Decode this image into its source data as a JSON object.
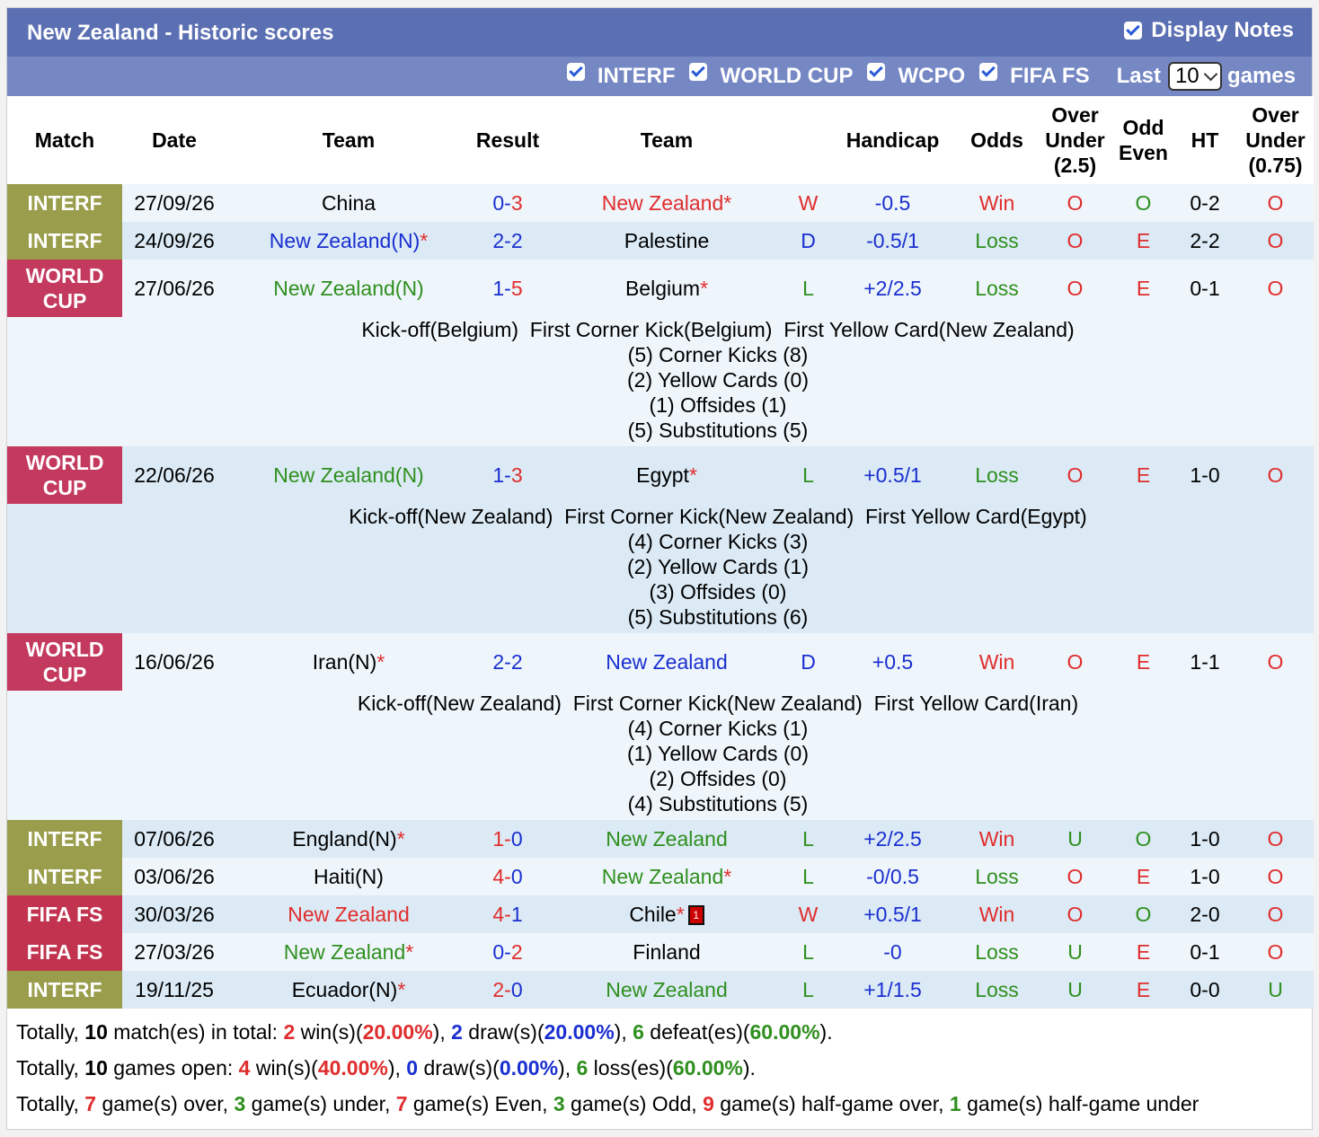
{
  "header": {
    "title": "New Zealand - Historic scores",
    "display_notes": "Display Notes"
  },
  "filters": {
    "items": [
      "INTERF",
      "WORLD CUP",
      "WCPO",
      "FIFA FS"
    ],
    "last_label": "Last",
    "last_value": "10",
    "games_label": "games"
  },
  "columns": [
    "Match",
    "Date",
    "Team",
    "Result",
    "Team",
    "",
    "Handicap",
    "Odds",
    "Over Under (2.5)",
    "Odd Even",
    "HT",
    "Over Under (0.75)"
  ],
  "rows": [
    {
      "league": "INTERF",
      "date": "27/09/26",
      "home": "China",
      "home_color": "#000000",
      "home_star": "",
      "res_h": "0",
      "res_a": "3",
      "res_h_color": "#1a2fd0",
      "res_a_color": "#e02d2d",
      "away": "New Zealand",
      "away_color": "#e02d2d",
      "away_star": "*",
      "wdl": "W",
      "handicap": "-0.5",
      "odds": "Win",
      "ou": "O",
      "oe": "O",
      "ht": "0-2",
      "ou2": "O"
    },
    {
      "league": "INTERF",
      "date": "24/09/26",
      "home": "New Zealand(N)",
      "home_color": "#1a2fd0",
      "home_star": "*",
      "res_h": "2",
      "res_a": "2",
      "res_h_color": "#1a2fd0",
      "res_a_color": "#1a2fd0",
      "away": "Palestine",
      "away_color": "#000000",
      "away_star": "",
      "wdl": "D",
      "handicap": "-0.5/1",
      "odds": "Loss",
      "ou": "O",
      "oe": "E",
      "ht": "2-2",
      "ou2": "O"
    },
    {
      "league": "WORLD CUP",
      "date": "27/06/26",
      "home": "New Zealand(N)",
      "home_color": "#2f8f1f",
      "home_star": "",
      "res_h": "1",
      "res_a": "5",
      "res_h_color": "#1a2fd0",
      "res_a_color": "#e02d2d",
      "away": "Belgium",
      "away_color": "#000000",
      "away_star": "*",
      "wdl": "L",
      "handicap": "+2/2.5",
      "odds": "Loss",
      "ou": "O",
      "oe": "E",
      "ht": "0-1",
      "ou2": "O",
      "notes": {
        "line1": "Kick-off(Belgium)  First Corner Kick(Belgium)  First Yellow Card(New Zealand)",
        "corners": "(5) Corner Kicks (8)",
        "yellow": "(2) Yellow Cards (0)",
        "offsides": "(1) Offsides (1)",
        "subs": "(5) Substitutions (5)"
      }
    },
    {
      "league": "WORLD CUP",
      "date": "22/06/26",
      "home": "New Zealand(N)",
      "home_color": "#2f8f1f",
      "home_star": "",
      "res_h": "1",
      "res_a": "3",
      "res_h_color": "#1a2fd0",
      "res_a_color": "#e02d2d",
      "away": "Egypt",
      "away_color": "#000000",
      "away_star": "*",
      "wdl": "L",
      "handicap": "+0.5/1",
      "odds": "Loss",
      "ou": "O",
      "oe": "E",
      "ht": "1-0",
      "ou2": "O",
      "notes": {
        "line1": "Kick-off(New Zealand)  First Corner Kick(New Zealand)  First Yellow Card(Egypt)",
        "corners": "(4) Corner Kicks (3)",
        "yellow": "(2) Yellow Cards (1)",
        "offsides": "(3) Offsides (0)",
        "subs": "(5) Substitutions (6)"
      }
    },
    {
      "league": "WORLD CUP",
      "date": "16/06/26",
      "home": "Iran(N)",
      "home_color": "#000000",
      "home_star": "*",
      "res_h": "2",
      "res_a": "2",
      "res_h_color": "#1a2fd0",
      "res_a_color": "#1a2fd0",
      "away": "New Zealand",
      "away_color": "#1a2fd0",
      "away_star": "",
      "wdl": "D",
      "handicap": "+0.5",
      "odds": "Win",
      "ou": "O",
      "oe": "E",
      "ht": "1-1",
      "ou2": "O",
      "notes": {
        "line1": "Kick-off(New Zealand)  First Corner Kick(New Zealand)  First Yellow Card(Iran)",
        "corners": "(4) Corner Kicks (1)",
        "yellow": "(1) Yellow Cards (0)",
        "offsides": "(2) Offsides (0)",
        "subs": "(4) Substitutions (5)"
      }
    },
    {
      "league": "INTERF",
      "date": "07/06/26",
      "home": "England(N)",
      "home_color": "#000000",
      "home_star": "*",
      "res_h": "1",
      "res_a": "0",
      "res_h_color": "#e02d2d",
      "res_a_color": "#1a2fd0",
      "away": "New Zealand",
      "away_color": "#2f8f1f",
      "away_star": "",
      "wdl": "L",
      "handicap": "+2/2.5",
      "odds": "Win",
      "ou": "U",
      "oe": "O",
      "ht": "1-0",
      "ou2": "O"
    },
    {
      "league": "INTERF",
      "date": "03/06/26",
      "home": "Haiti(N)",
      "home_color": "#000000",
      "home_star": "",
      "res_h": "4",
      "res_a": "0",
      "res_h_color": "#e02d2d",
      "res_a_color": "#1a2fd0",
      "away": "New Zealand",
      "away_color": "#2f8f1f",
      "away_star": "*",
      "wdl": "L",
      "handicap": "-0/0.5",
      "odds": "Loss",
      "ou": "O",
      "oe": "E",
      "ht": "1-0",
      "ou2": "O"
    },
    {
      "league": "FIFA FS",
      "date": "30/03/26",
      "home": "New Zealand",
      "home_color": "#e02d2d",
      "home_star": "",
      "res_h": "4",
      "res_a": "1",
      "res_h_color": "#e02d2d",
      "res_a_color": "#1a2fd0",
      "away": "Chile",
      "away_color": "#000000",
      "away_star": "*",
      "redcard": "1",
      "wdl": "W",
      "handicap": "+0.5/1",
      "odds": "Win",
      "ou": "O",
      "oe": "O",
      "ht": "2-0",
      "ou2": "O"
    },
    {
      "league": "FIFA FS",
      "date": "27/03/26",
      "home": "New Zealand",
      "home_color": "#2f8f1f",
      "home_star": "*",
      "res_h": "0",
      "res_a": "2",
      "res_h_color": "#1a2fd0",
      "res_a_color": "#e02d2d",
      "away": "Finland",
      "away_color": "#000000",
      "away_star": "",
      "wdl": "L",
      "handicap": "-0",
      "odds": "Loss",
      "ou": "U",
      "oe": "E",
      "ht": "0-1",
      "ou2": "O"
    },
    {
      "league": "INTERF",
      "date": "19/11/25",
      "home": "Ecuador(N)",
      "home_color": "#000000",
      "home_star": "*",
      "res_h": "2",
      "res_a": "0",
      "res_h_color": "#e02d2d",
      "res_a_color": "#1a2fd0",
      "away": "New Zealand",
      "away_color": "#2f8f1f",
      "away_star": "",
      "wdl": "L",
      "handicap": "+1/1.5",
      "odds": "Loss",
      "ou": "U",
      "oe": "E",
      "ht": "0-0",
      "ou2": "U"
    }
  ],
  "colors": {
    "win": "#e02d2d",
    "draw": "#1a2fd0",
    "loss": "#2f8f1f",
    "interf": "#9a9e4c",
    "worldcup": "#c4395e",
    "fifafs": "#c1334e"
  },
  "summary": {
    "line1": {
      "p1": "Totally, ",
      "n": "10",
      "p2": " match(es) in total: ",
      "w": "2",
      "p3": " win(s)(",
      "wp": "20.00%",
      "p4": "), ",
      "d": "2",
      "p5": " draw(s)(",
      "dp": "20.00%",
      "p6": "), ",
      "l": "6",
      "p7": " defeat(es)(",
      "lp": "60.00%",
      "p8": ")."
    },
    "line2": {
      "p1": "Totally, ",
      "n": "10",
      "p2": " games open: ",
      "w": "4",
      "p3": " win(s)(",
      "wp": "40.00%",
      "p4": "), ",
      "d": "0",
      "p5": " draw(s)(",
      "dp": "0.00%",
      "p6": "), ",
      "l": "6",
      "p7": " loss(es)(",
      "lp": "60.00%",
      "p8": ")."
    },
    "line3": {
      "p1": "Totally, ",
      "over": "7",
      "p2": " game(s) over, ",
      "under": "3",
      "p3": " game(s) under, ",
      "even": "7",
      "p4": " game(s) Even, ",
      "odd": "3",
      "p5": " game(s) Odd, ",
      "hgo": "9",
      "p6": " game(s) half-game over, ",
      "hgu": "1",
      "p7": " game(s) half-game under"
    }
  }
}
